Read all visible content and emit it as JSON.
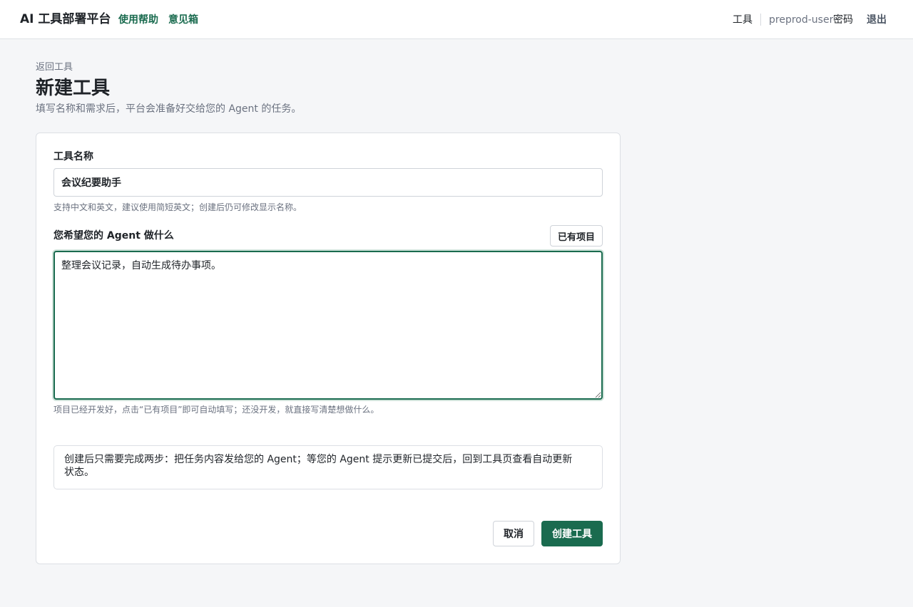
{
  "header": {
    "brand": "AI 工具部署平台",
    "help_link": "使用帮助",
    "feedback_link": "意见箱",
    "tools_link": "工具",
    "username": "preprod-user",
    "password_link": "密码",
    "logout_link": "退出"
  },
  "page": {
    "back_link": "返回工具",
    "title": "新建工具",
    "subtitle": "填写名称和需求后，平台会准备好交给您的 Agent 的任务。"
  },
  "form": {
    "name_label": "工具名称",
    "name_value": "会议纪要助手",
    "name_hint": "支持中文和英文，建议使用简短英文；创建后仍可修改显示名称。",
    "task_label": "您希望您的 Agent 做什么",
    "existing_project_button": "已有项目",
    "task_value": "整理会议记录，自动生成待办事项。",
    "task_hint": "项目已经开发好，点击“已有项目”即可自动填写；还没开发，就直接写清楚想做什么。",
    "notice": "创建后只需要完成两步：把任务内容发给您的 Agent；等您的 Agent 提示更新已提交后，回到工具页查看自动更新状态。",
    "cancel_button": "取消",
    "create_button": "创建工具"
  },
  "colors": {
    "accent": "#1a6b4f",
    "background": "#f5f6f8",
    "muted_text": "#6b7280"
  }
}
